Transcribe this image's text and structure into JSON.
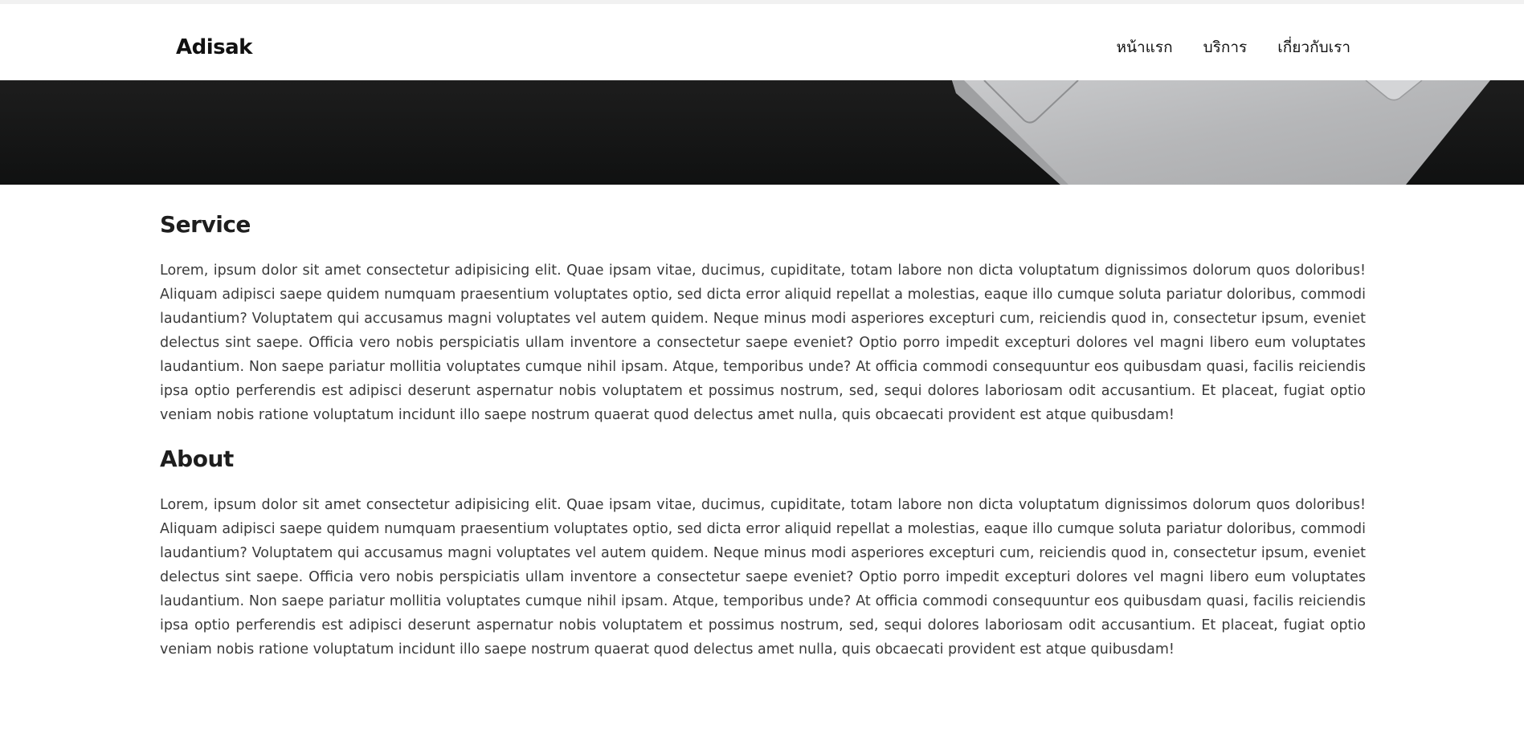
{
  "header": {
    "brand": "Adisak",
    "nav": [
      {
        "label": "หน้าแรก"
      },
      {
        "label": "บริการ"
      },
      {
        "label": "เกี่ยวกับเรา"
      }
    ]
  },
  "hero": {
    "image": "laptop-on-dark-desk-photo"
  },
  "sections": {
    "service": {
      "title": "Service",
      "body": "Lorem, ipsum dolor sit amet consectetur adipisicing elit. Quae ipsam vitae, ducimus, cupiditate, totam labore non dicta voluptatum dignissimos dolorum quos doloribus! Aliquam adipisci saepe quidem numquam praesentium voluptates optio, sed dicta error aliquid repellat a molestias, eaque illo cumque soluta pariatur doloribus, commodi laudantium? Voluptatem qui accusamus magni voluptates vel autem quidem. Neque minus modi asperiores excepturi cum, reiciendis quod in, consectetur ipsum, eveniet delectus sint saepe. Officia vero nobis perspiciatis ullam inventore a consectetur saepe eveniet? Optio porro impedit excepturi dolores vel magni libero eum voluptates laudantium. Non saepe pariatur mollitia voluptates cumque nihil ipsam. Atque, temporibus unde? At officia commodi consequuntur eos quibusdam quasi, facilis reiciendis ipsa optio perferendis est adipisci deserunt aspernatur nobis voluptatem et possimus nostrum, sed, sequi dolores laboriosam odit accusantium. Et placeat, fugiat optio veniam nobis ratione voluptatum incidunt illo saepe nostrum quaerat quod delectus amet nulla, quis obcaecati provident est atque quibusdam!"
    },
    "about": {
      "title": "About",
      "body": "Lorem, ipsum dolor sit amet consectetur adipisicing elit. Quae ipsam vitae, ducimus, cupiditate, totam labore non dicta voluptatum dignissimos dolorum quos doloribus! Aliquam adipisci saepe quidem numquam praesentium voluptates optio, sed dicta error aliquid repellat a molestias, eaque illo cumque soluta pariatur doloribus, commodi laudantium? Voluptatem qui accusamus magni voluptates vel autem quidem. Neque minus modi asperiores excepturi cum, reiciendis quod in, consectetur ipsum, eveniet delectus sint saepe. Officia vero nobis perspiciatis ullam inventore a consectetur saepe eveniet? Optio porro impedit excepturi dolores vel magni libero eum voluptates laudantium. Non saepe pariatur mollitia voluptates cumque nihil ipsam. Atque, temporibus unde? At officia commodi consequuntur eos quibusdam quasi, facilis reiciendis ipsa optio perferendis est adipisci deserunt aspernatur nobis voluptatem et possimus nostrum, sed, sequi dolores laboriosam odit accusantium. Et placeat, fugiat optio veniam nobis ratione voluptatum incidunt illo saepe nostrum quaerat quod delectus amet nulla, quis obcaecati provident est atque quibusdam!"
    }
  },
  "colors": {
    "background": "#ffffff",
    "text": "#3a3a3a",
    "heading": "#1e1e1e",
    "hero_dark": "#141414",
    "laptop_silver": "#b9babc"
  }
}
